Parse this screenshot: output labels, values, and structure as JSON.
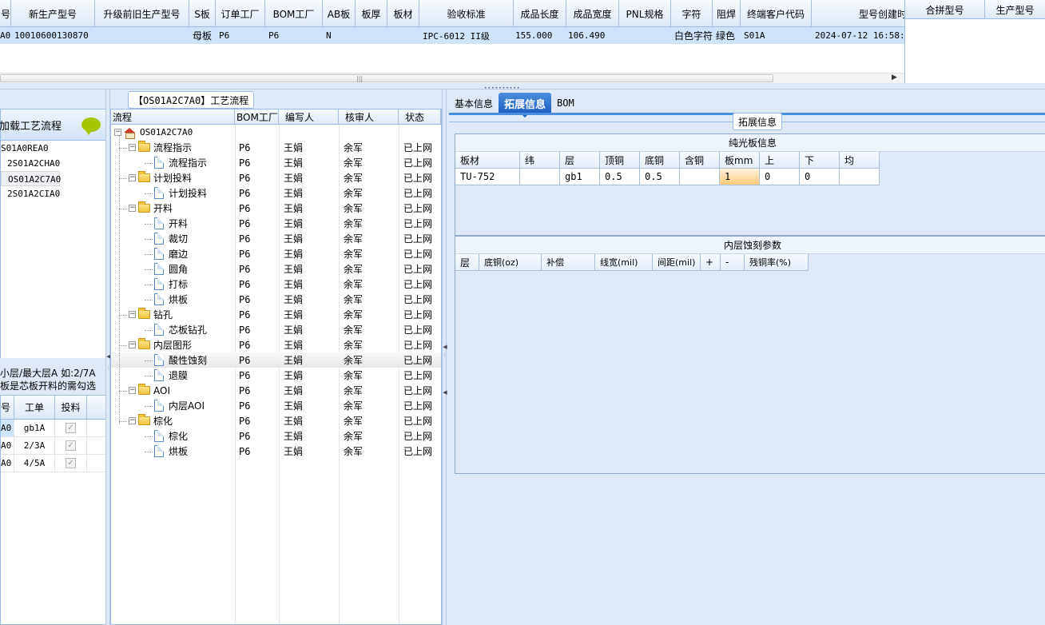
{
  "top_grid": {
    "columns": [
      "号",
      "新生产型号",
      "升级前旧生产型号",
      "S板",
      "订单工厂",
      "BOM工厂",
      "AB板",
      "板厚",
      "板材",
      "验收标准",
      "成品长度",
      "成品宽度",
      "PNL规格",
      "字符",
      "阻焊",
      "终端客户代码",
      "型号创建时"
    ],
    "row": [
      "A0",
      "10010600130870",
      "",
      "母板",
      "P6",
      "P6",
      "N",
      "",
      "",
      "IPC-6012 II级",
      "155.000",
      "106.490",
      "",
      "白色字符",
      "绿色",
      "S01A",
      "2024-07-12 16:58:09"
    ]
  },
  "right_grid": {
    "columns": [
      "合拼型号",
      "生产型号"
    ]
  },
  "left_panel": {
    "header": "加载工艺流程",
    "items": [
      "S01A0REA0",
      "2S01A2CHA0",
      "OS01A2C7A0",
      "2S01A2CIA0"
    ],
    "note_line1": "小层/最大层A 如:2/7A",
    "note_line2": "板是芯板开料的需勾选",
    "grid_columns": [
      "号",
      "工单",
      "投料"
    ],
    "grid_rows": [
      {
        "id": "A0",
        "order": "gb1A"
      },
      {
        "id": "A0",
        "order": "2/3A"
      },
      {
        "id": "A0",
        "order": "4/5A"
      }
    ]
  },
  "process_panel": {
    "title": "【OS01A2C7A0】工艺流程",
    "columns": [
      "流程",
      "BOM工厂",
      "编写人",
      "核审人",
      "状态"
    ],
    "root": "OS01A2C7A0",
    "rows": [
      {
        "name": "流程指示",
        "level": 1,
        "factory": "P6",
        "writer": "王娟",
        "reviewer": "余军",
        "status": "已上网"
      },
      {
        "name": "流程指示",
        "level": 2,
        "factory": "P6",
        "writer": "王娟",
        "reviewer": "余军",
        "status": "已上网"
      },
      {
        "name": "计划投料",
        "level": 1,
        "factory": "P6",
        "writer": "王娟",
        "reviewer": "余军",
        "status": "已上网"
      },
      {
        "name": "计划投料",
        "level": 2,
        "factory": "P6",
        "writer": "王娟",
        "reviewer": "余军",
        "status": "已上网"
      },
      {
        "name": "开料",
        "level": 1,
        "factory": "P6",
        "writer": "王娟",
        "reviewer": "余军",
        "status": "已上网"
      },
      {
        "name": "开料",
        "level": 2,
        "factory": "P6",
        "writer": "王娟",
        "reviewer": "余军",
        "status": "已上网"
      },
      {
        "name": "裁切",
        "level": 2,
        "factory": "P6",
        "writer": "王娟",
        "reviewer": "余军",
        "status": "已上网"
      },
      {
        "name": "磨边",
        "level": 2,
        "factory": "P6",
        "writer": "王娟",
        "reviewer": "余军",
        "status": "已上网"
      },
      {
        "name": "圆角",
        "level": 2,
        "factory": "P6",
        "writer": "王娟",
        "reviewer": "余军",
        "status": "已上网"
      },
      {
        "name": "打标",
        "level": 2,
        "factory": "P6",
        "writer": "王娟",
        "reviewer": "余军",
        "status": "已上网"
      },
      {
        "name": "烘板",
        "level": 2,
        "factory": "P6",
        "writer": "王娟",
        "reviewer": "余军",
        "status": "已上网"
      },
      {
        "name": "钻孔",
        "level": 1,
        "factory": "P6",
        "writer": "王娟",
        "reviewer": "余军",
        "status": "已上网"
      },
      {
        "name": "芯板钻孔",
        "level": 2,
        "factory": "P6",
        "writer": "王娟",
        "reviewer": "余军",
        "status": "已上网"
      },
      {
        "name": "内层图形",
        "level": 1,
        "factory": "P6",
        "writer": "王娟",
        "reviewer": "余军",
        "status": "已上网"
      },
      {
        "name": "酸性蚀刻",
        "level": 2,
        "factory": "P6",
        "writer": "王娟",
        "reviewer": "余军",
        "status": "已上网"
      },
      {
        "name": "退膜",
        "level": 2,
        "factory": "P6",
        "writer": "王娟",
        "reviewer": "余军",
        "status": "已上网"
      },
      {
        "name": "AOI",
        "level": 1,
        "factory": "P6",
        "writer": "王娟",
        "reviewer": "余军",
        "status": "已上网"
      },
      {
        "name": "内层AOI",
        "level": 2,
        "factory": "P6",
        "writer": "王娟",
        "reviewer": "余军",
        "status": "已上网"
      },
      {
        "name": "棕化",
        "level": 1,
        "factory": "P6",
        "writer": "王娟",
        "reviewer": "余军",
        "status": "已上网"
      },
      {
        "name": "棕化",
        "level": 2,
        "factory": "P6",
        "writer": "王娟",
        "reviewer": "余军",
        "status": "已上网"
      },
      {
        "name": "烘板",
        "level": 2,
        "factory": "P6",
        "writer": "王娟",
        "reviewer": "余军",
        "status": "已上网"
      }
    ]
  },
  "detail_panel": {
    "tabs": [
      "基本信息",
      "拓展信息",
      "BOM"
    ],
    "group_label": "拓展信息",
    "plain_board": {
      "title": "纯光板信息",
      "columns": [
        "板材",
        "纬",
        "层",
        "顶铜",
        "底铜",
        "含铜",
        "板mm",
        "上",
        "下",
        "均"
      ],
      "row": [
        "TU-752",
        "",
        "gb1",
        "0.5",
        "0.5",
        "",
        "1",
        "0",
        "0",
        ""
      ]
    },
    "inner_etch": {
      "title": "内层蚀刻参数",
      "columns": [
        "层",
        "底铜(oz)",
        "补偿",
        "线宽(mil)",
        "间距(mil)",
        "+",
        "-",
        "残铜率(%)"
      ]
    }
  }
}
